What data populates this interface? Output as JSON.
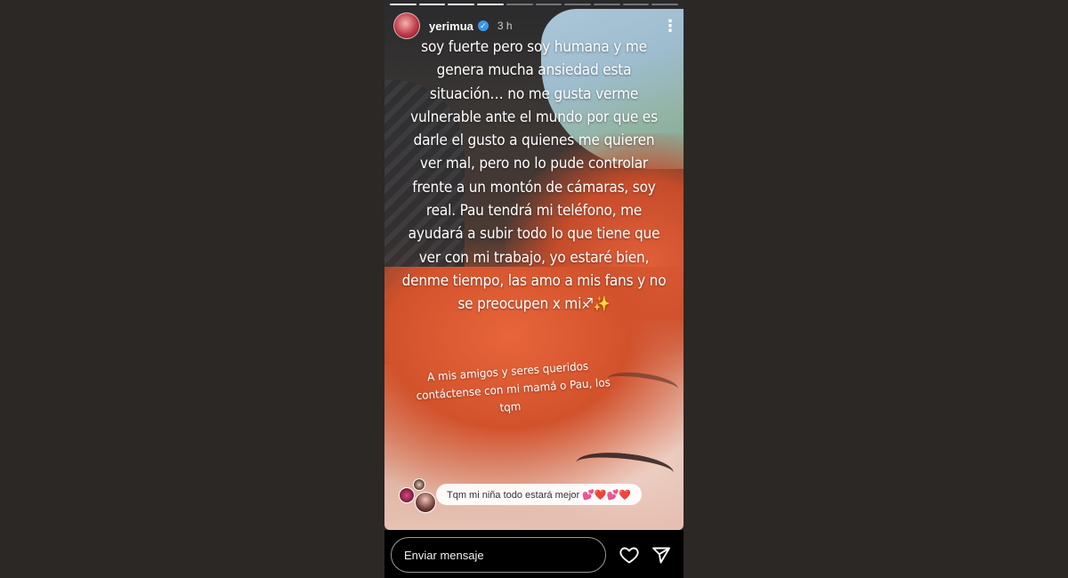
{
  "story": {
    "progress_segments": 10,
    "progress_completed": 4,
    "user": {
      "username": "yerimua",
      "verified": true,
      "time_ago": "3 h"
    },
    "text_lines": [
      "soy fuerte pero soy humana y me",
      "genera mucha ansiedad esta",
      "situación… no me gusta verme",
      "vulnerable ante el mundo por que es",
      "darle el gusto a quienes me quieren",
      "ver mal, pero no lo pude controlar",
      "frente a un montón de cámaras, soy",
      "real. Pau tendrá mi teléfono, me",
      "ayudará a subir todo lo que tiene que",
      "ver con mi trabajo, yo estaré bien,",
      "denme tiempo, las amo a mis fans y no",
      "se preocupen x mi♐✨"
    ],
    "sub_text_lines": [
      "A mis amigos y seres queridos",
      "contáctense con mi mamá o Pau, los",
      "tqm"
    ],
    "reply": {
      "text": "Tqm mi niña todo estará mejor 💕❤️💕❤️"
    }
  },
  "bottom_bar": {
    "message_placeholder": "Enviar mensaje",
    "like_icon": "heart-icon",
    "share_icon": "send-icon"
  },
  "colors": {
    "page_background": "#2b2826",
    "verified_badge": "#3897f0",
    "bottom_bar": "#000000"
  }
}
